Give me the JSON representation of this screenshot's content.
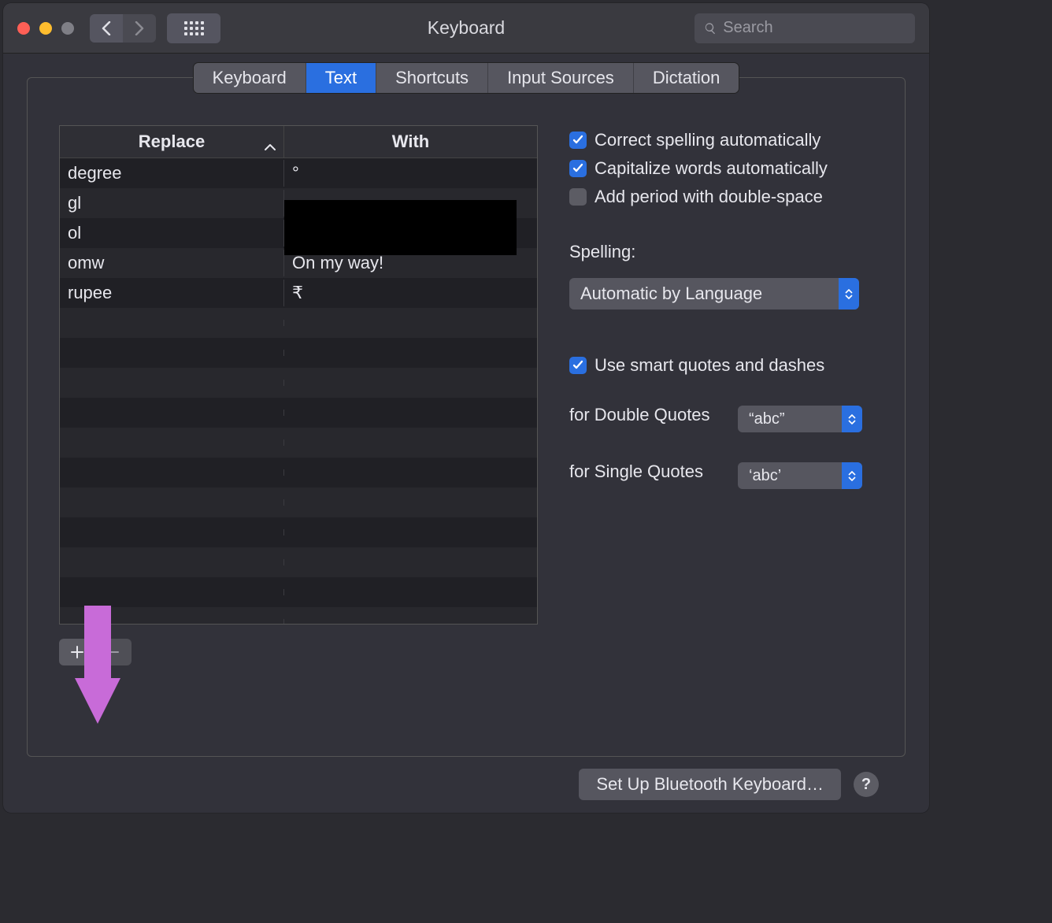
{
  "window": {
    "title": "Keyboard"
  },
  "search": {
    "placeholder": "Search"
  },
  "tabs": {
    "items": [
      "Keyboard",
      "Text",
      "Shortcuts",
      "Input Sources",
      "Dictation"
    ],
    "active_index": 1
  },
  "table": {
    "columns": {
      "replace": "Replace",
      "with": "With"
    },
    "rows": [
      {
        "replace": "degree",
        "with": "°"
      },
      {
        "replace": "gl",
        "with": ""
      },
      {
        "replace": "ol",
        "with": ""
      },
      {
        "replace": "omw",
        "with": "On my way!"
      },
      {
        "replace": "rupee",
        "with": "₹"
      }
    ]
  },
  "options": {
    "correct_spelling": {
      "label": "Correct spelling automatically",
      "checked": true
    },
    "capitalize": {
      "label": "Capitalize words automatically",
      "checked": true
    },
    "double_space": {
      "label": "Add period with double-space",
      "checked": false
    },
    "spelling_label": "Spelling:",
    "spelling_value": "Automatic by Language",
    "smart_quotes": {
      "label": "Use smart quotes and dashes",
      "checked": true
    },
    "double_quotes": {
      "label": "for Double Quotes",
      "value": "“abc”"
    },
    "single_quotes": {
      "label": "for Single Quotes",
      "value": "‘abc’"
    }
  },
  "footer": {
    "button": "Set Up Bluetooth Keyboard…",
    "help": "?"
  }
}
